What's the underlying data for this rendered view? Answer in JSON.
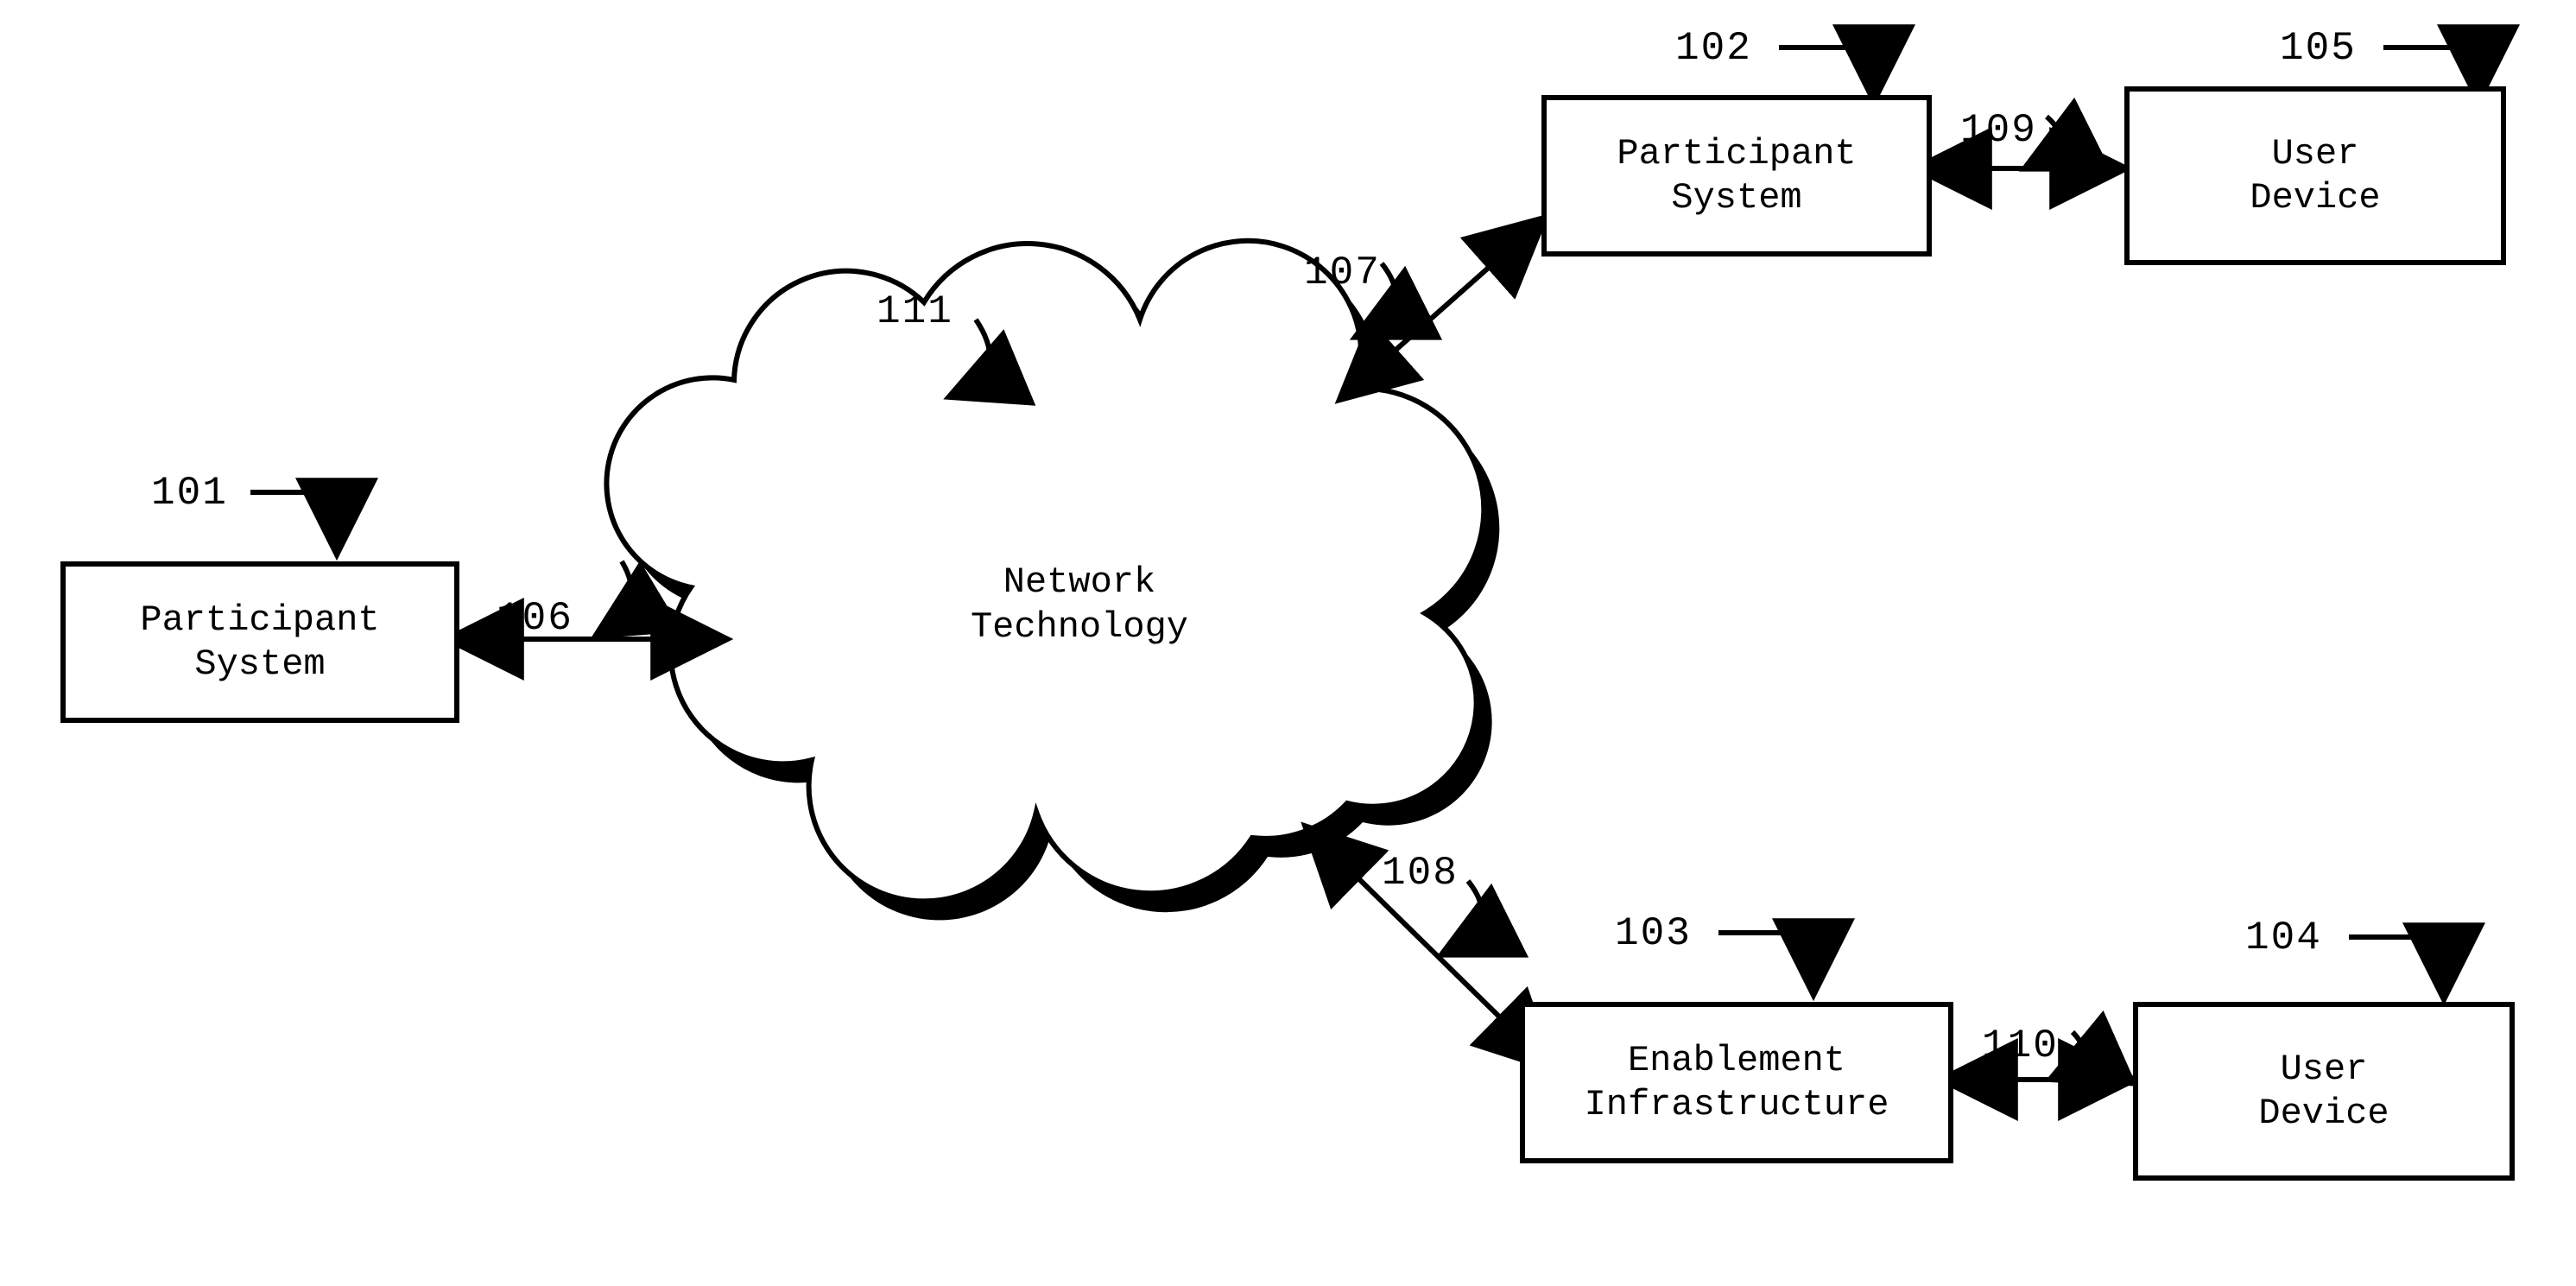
{
  "nodes": {
    "participant_system_left": {
      "line1": "Participant",
      "line2": "System"
    },
    "participant_system_right": {
      "line1": "Participant",
      "line2": "System"
    },
    "enablement_infrastructure": {
      "line1": "Enablement",
      "line2": "Infrastructure"
    },
    "user_device_top": {
      "line1": "User",
      "line2": "Device"
    },
    "user_device_bottom": {
      "line1": "User",
      "line2": "Device"
    },
    "cloud": {
      "line1": "Network",
      "line2": "Technology"
    }
  },
  "refs": {
    "r101": "101",
    "r102": "102",
    "r103": "103",
    "r104": "104",
    "r105": "105",
    "r106": "106",
    "r107": "107",
    "r108": "108",
    "r109": "109",
    "r110": "110",
    "r111": "111"
  }
}
